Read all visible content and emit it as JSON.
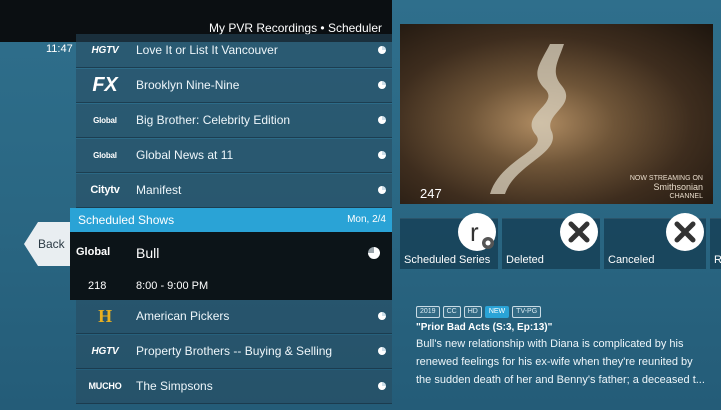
{
  "header": {
    "title": "My PVR Recordings  •  Scheduler"
  },
  "list_top": [
    {
      "time": "11:47",
      "logo": "HGTV",
      "title": "Love It or List It Vancouver"
    },
    {
      "time": "",
      "logo": "FX",
      "title": "Brooklyn Nine-Nine"
    },
    {
      "time": "",
      "logo": "Global",
      "title": "Big Brother: Celebrity Edition"
    },
    {
      "time": "",
      "logo": "Global",
      "title": "Global News at 11"
    },
    {
      "time": "",
      "logo": "Citytv",
      "title": "Manifest"
    }
  ],
  "scheduled": {
    "header": "Scheduled Shows",
    "date": "Mon, 2/4",
    "logo": "Global",
    "title": "Bull",
    "channel": "218",
    "timeslot": "8:00 - 9:00 PM"
  },
  "list_bottom": [
    {
      "logo": "H HISTORY",
      "title": "American Pickers"
    },
    {
      "logo": "HGTV",
      "title": "Property Brothers -- Buying & Selling"
    },
    {
      "logo": "MUCHO",
      "title": "The Simpsons"
    }
  ],
  "back_label": "Back",
  "preview": {
    "channel": "247",
    "watermark_line1": "NOW STREAMING ON",
    "watermark_line2": "Smithsonian",
    "watermark_line3": "CHANNEL"
  },
  "tiles": [
    {
      "label": "Scheduled Series",
      "icon": "scheduled-series-icon"
    },
    {
      "label": "Deleted",
      "icon": "close-icon"
    },
    {
      "label": "Canceled",
      "icon": "close-icon"
    },
    {
      "label": "R",
      "icon": ""
    }
  ],
  "details": {
    "badges": [
      "2019",
      "CC",
      "HD",
      "NEW",
      "TV-PG"
    ],
    "episode": "\"Prior Bad Acts (S:3, Ep:13)\"",
    "description": "Bull's new relationship with Diana is complicated by his renewed feelings for his ex-wife when they're reunited by the sudden death of her and Benny's father; a deceased t..."
  },
  "colors": {
    "accent": "#2aa3d6",
    "background": "#2a6783",
    "panel": "#0c1418"
  }
}
